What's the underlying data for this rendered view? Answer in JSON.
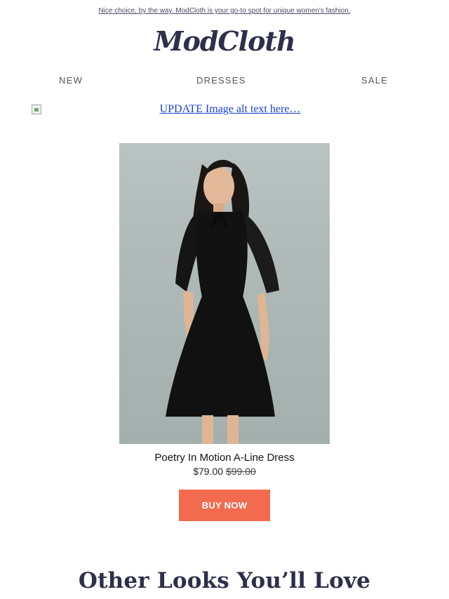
{
  "preheader": {
    "text": "Nice choice, by the way. ModCloth is your go-to spot for unique women's fashion."
  },
  "brand": {
    "logo_text": "ModCloth"
  },
  "nav": {
    "items": [
      {
        "label": "NEW"
      },
      {
        "label": "DRESSES"
      },
      {
        "label": "SALE"
      }
    ]
  },
  "banner": {
    "alt_text": "UPDATE Image alt text here…"
  },
  "product": {
    "image_alt": "Poetry In Motion A-Line Dress",
    "name": "Poetry In Motion A-Line Dress",
    "price": "$79.00",
    "original_price": "$99.00",
    "button_label": "BUY NOW"
  },
  "section": {
    "title": "Other Looks You’ll Love"
  },
  "colors": {
    "brand_navy": "#2e2f4a",
    "button_coral": "#f26b4f",
    "link_blue": "#1a3fd0"
  }
}
